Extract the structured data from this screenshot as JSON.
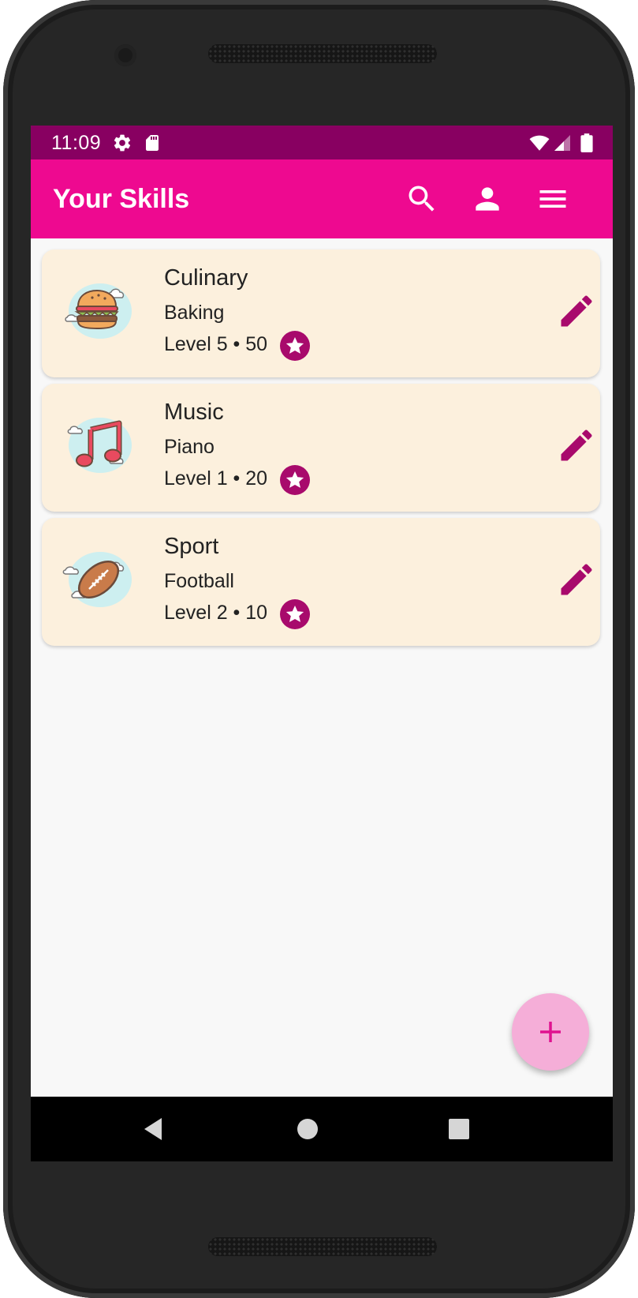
{
  "status": {
    "time": "11:09",
    "icons": [
      "settings-icon",
      "sd-card-icon",
      "wifi-icon",
      "signal-icon",
      "battery-icon"
    ]
  },
  "appbar": {
    "title": "Your Skills",
    "actions": [
      "search-icon",
      "account-icon",
      "menu-icon"
    ]
  },
  "skills": [
    {
      "category": "Culinary",
      "skill": "Baking",
      "level_text": "Level 5 • 50",
      "icon": "burger-icon"
    },
    {
      "category": "Music",
      "skill": "Piano",
      "level_text": "Level 1 • 20",
      "icon": "music-note-icon"
    },
    {
      "category": "Sport",
      "skill": "Football",
      "level_text": "Level 2 • 10",
      "icon": "football-icon"
    }
  ],
  "fab": {
    "icon": "plus-icon"
  },
  "navigation": [
    "back-icon",
    "home-icon",
    "recents-icon"
  ],
  "colors": {
    "status_bar": "#880061",
    "app_bar": "#ee0990",
    "card_bg": "#fcf0dd",
    "accent": "#a80a6c",
    "fab_bg": "#f5aed8",
    "fab_icon": "#e0128f"
  }
}
